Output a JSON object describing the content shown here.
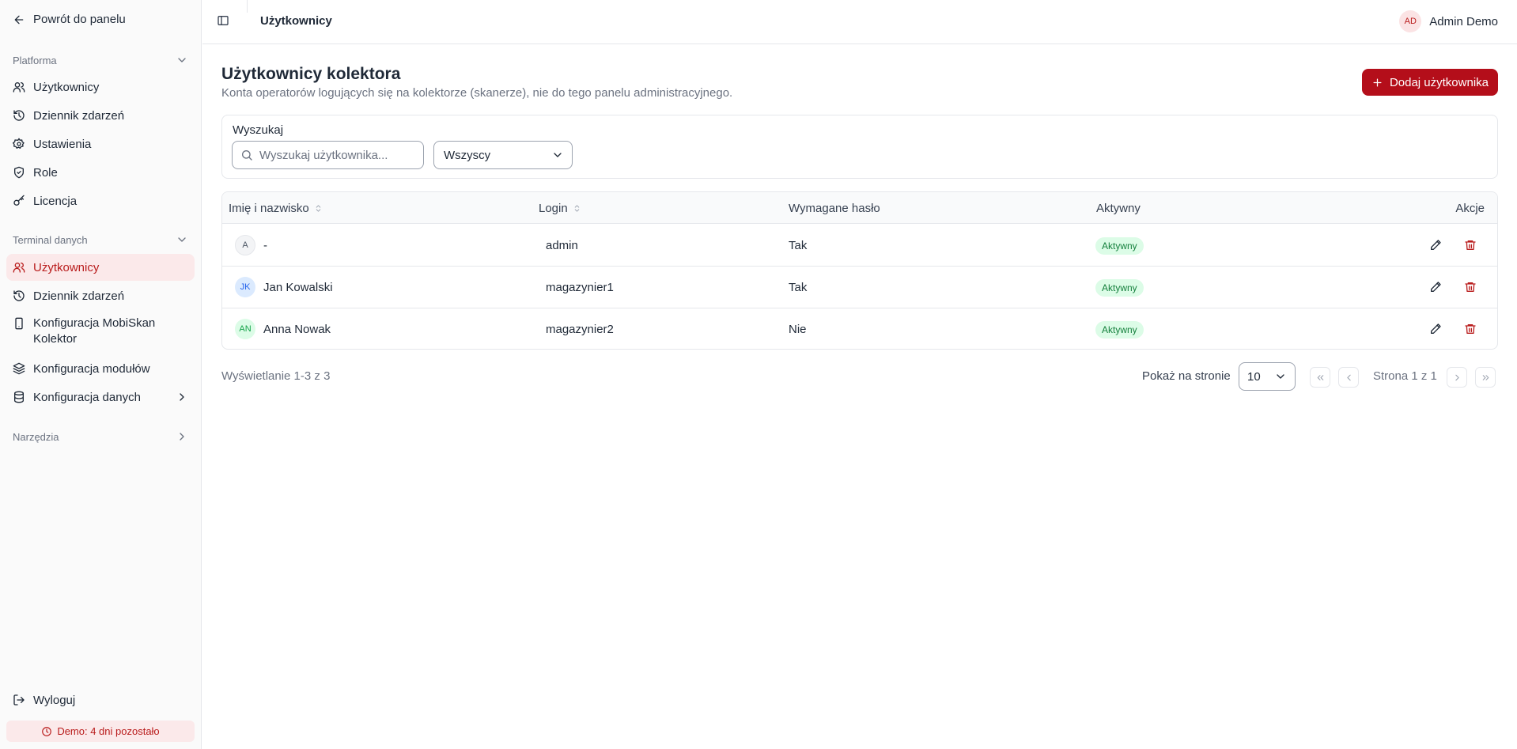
{
  "colors": {
    "accent": "#b40e1a",
    "active_bg": "#fbe9ea",
    "badge_bg": "#dcfce7",
    "badge_text": "#15803d"
  },
  "sidebar": {
    "back_label": "Powrót do panelu",
    "groups": [
      {
        "title": "Platforma",
        "items": [
          {
            "label": "Użytkownicy",
            "icon": "users-icon"
          },
          {
            "label": "Dziennik zdarzeń",
            "icon": "history-icon"
          },
          {
            "label": "Ustawienia",
            "icon": "gear-icon"
          },
          {
            "label": "Role",
            "icon": "shield-icon"
          },
          {
            "label": "Licencja",
            "icon": "key-icon"
          }
        ]
      },
      {
        "title": "Terminal danych",
        "items": [
          {
            "label": "Użytkownicy",
            "icon": "users-icon",
            "active": true
          },
          {
            "label": "Dziennik zdarzeń",
            "icon": "history-icon"
          },
          {
            "label": "Konfiguracja MobiSkan Kolektor",
            "icon": "smartphone-icon"
          },
          {
            "label": "Konfiguracja modułów",
            "icon": "layers-icon"
          },
          {
            "label": "Konfiguracja danych",
            "icon": "database-icon"
          }
        ]
      },
      {
        "title": "Narzędzia",
        "items": []
      }
    ],
    "logout_label": "Wyloguj",
    "demo_label": "Demo: 4 dni pozostało"
  },
  "topbar": {
    "title": "Użytkownicy",
    "user_initials": "AD",
    "user_name": "Admin Demo"
  },
  "main": {
    "title": "Użytkownicy kolektora",
    "subtitle": "Konta operatorów logujących się na kolektorze (skanerze), nie do tego panelu administracyjnego.",
    "add_button_label": "Dodaj użytkownika",
    "search_label": "Wyszukaj",
    "search_placeholder": "Wyszukaj użytkownika...",
    "status_filter_value": "Wszyscy"
  },
  "table": {
    "columns": [
      "Imię i nazwisko",
      "Login",
      "Wymagane hasło",
      "Aktywny",
      "Akcje"
    ],
    "rows": [
      {
        "initials": "A",
        "name": "-",
        "login": "admin",
        "password_required": "Tak",
        "status": "Aktywny",
        "avatar_bg": "#f3f4f6",
        "avatar_fg": "#4b5563"
      },
      {
        "initials": "JK",
        "name": "Jan Kowalski",
        "login": "magazynier1",
        "password_required": "Tak",
        "status": "Aktywny",
        "avatar_bg": "#dbeafe",
        "avatar_fg": "#2563eb"
      },
      {
        "initials": "AN",
        "name": "Anna Nowak",
        "login": "magazynier2",
        "password_required": "Nie",
        "status": "Aktywny",
        "avatar_bg": "#dcfce7",
        "avatar_fg": "#16a34a"
      }
    ]
  },
  "pagination": {
    "showing": "Wyświetlanie 1-3 z 3",
    "per_page_label": "Pokaż na stronie",
    "per_page_value": "10",
    "page_indicator": "Strona 1 z 1"
  }
}
